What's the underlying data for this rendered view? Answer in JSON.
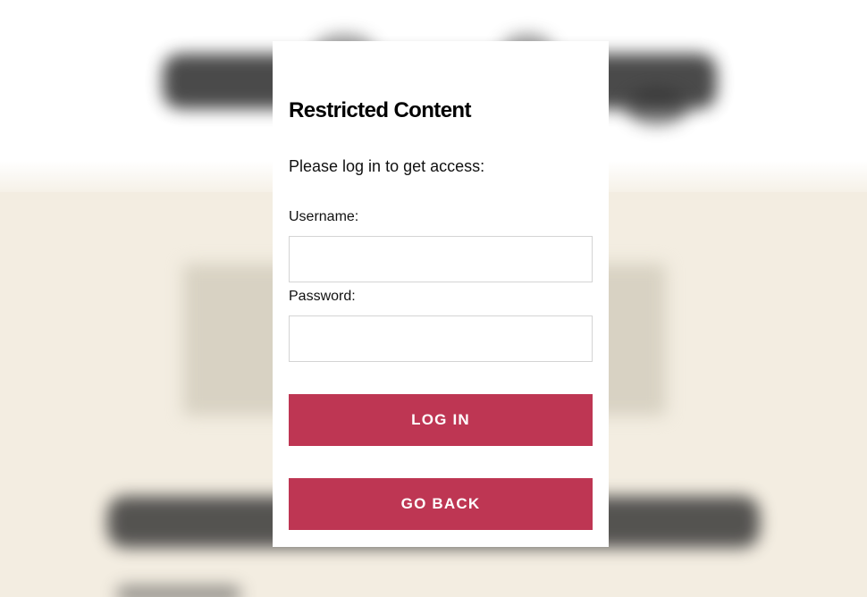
{
  "modal": {
    "title": "Restricted Content",
    "intro": "Please log in to get access:",
    "username_label": "Username:",
    "username_value": "",
    "password_label": "Password:",
    "password_value": "",
    "login_button": "LOG IN",
    "back_button": "GO BACK"
  },
  "colors": {
    "accent": "#be3653",
    "background": "#f3ede1",
    "modal_background": "#ffffff"
  }
}
